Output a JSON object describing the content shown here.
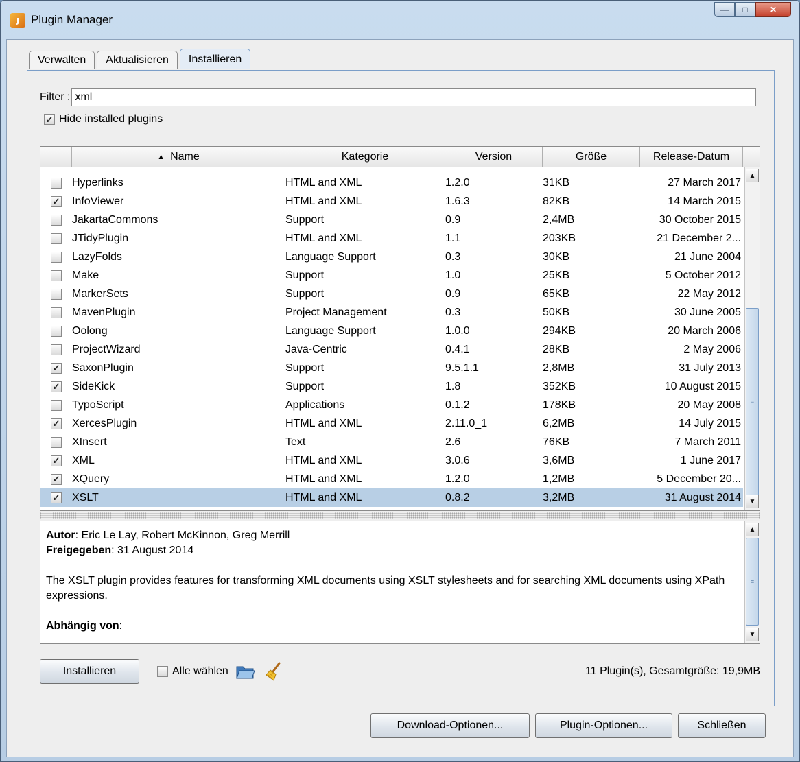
{
  "window": {
    "title": "Plugin Manager",
    "app_icon_text": "J"
  },
  "tabs": [
    {
      "label": "Verwalten"
    },
    {
      "label": "Aktualisieren"
    },
    {
      "label": "Installieren"
    }
  ],
  "filter": {
    "label": "Filter :",
    "value": "xml"
  },
  "hide_installed": {
    "label": "Hide installed plugins",
    "checked": true
  },
  "table": {
    "sort_indicator": "▲",
    "columns": [
      "Name",
      "Kategorie",
      "Version",
      "Größe",
      "Release-Datum"
    ],
    "rows": [
      {
        "checked": false,
        "name": "Hyperlinks",
        "category": "HTML and XML",
        "version": "1.2.0",
        "size": "31KB",
        "date": "27 March 2017"
      },
      {
        "checked": true,
        "name": "InfoViewer",
        "category": "HTML and XML",
        "version": "1.6.3",
        "size": "82KB",
        "date": "14 March 2015"
      },
      {
        "checked": false,
        "name": "JakartaCommons",
        "category": "Support",
        "version": "0.9",
        "size": "2,4MB",
        "date": "30 October 2015"
      },
      {
        "checked": false,
        "name": "JTidyPlugin",
        "category": "HTML and XML",
        "version": "1.1",
        "size": "203KB",
        "date": "21 December 2..."
      },
      {
        "checked": false,
        "name": "LazyFolds",
        "category": "Language Support",
        "version": "0.3",
        "size": "30KB",
        "date": "21 June 2004"
      },
      {
        "checked": false,
        "name": "Make",
        "category": "Support",
        "version": "1.0",
        "size": "25KB",
        "date": "5 October 2012"
      },
      {
        "checked": false,
        "name": "MarkerSets",
        "category": "Support",
        "version": "0.9",
        "size": "65KB",
        "date": "22 May 2012"
      },
      {
        "checked": false,
        "name": "MavenPlugin",
        "category": "Project Management",
        "version": "0.3",
        "size": "50KB",
        "date": "30 June 2005"
      },
      {
        "checked": false,
        "name": "Oolong",
        "category": "Language Support",
        "version": "1.0.0",
        "size": "294KB",
        "date": "20 March 2006"
      },
      {
        "checked": false,
        "name": "ProjectWizard",
        "category": "Java-Centric",
        "version": "0.4.1",
        "size": "28KB",
        "date": "2 May 2006"
      },
      {
        "checked": true,
        "name": "SaxonPlugin",
        "category": "Support",
        "version": "9.5.1.1",
        "size": "2,8MB",
        "date": "31 July 2013"
      },
      {
        "checked": true,
        "name": "SideKick",
        "category": "Support",
        "version": "1.8",
        "size": "352KB",
        "date": "10 August 2015"
      },
      {
        "checked": false,
        "name": "TypoScript",
        "category": "Applications",
        "version": "0.1.2",
        "size": "178KB",
        "date": "20 May 2008"
      },
      {
        "checked": true,
        "name": "XercesPlugin",
        "category": "HTML and XML",
        "version": "2.11.0_1",
        "size": "6,2MB",
        "date": "14 July 2015"
      },
      {
        "checked": false,
        "name": "XInsert",
        "category": "Text",
        "version": "2.6",
        "size": "76KB",
        "date": "7 March 2011"
      },
      {
        "checked": true,
        "name": "XML",
        "category": "HTML and XML",
        "version": "3.0.6",
        "size": "3,6MB",
        "date": "1 June 2017"
      },
      {
        "checked": true,
        "name": "XQuery",
        "category": "HTML and XML",
        "version": "1.2.0",
        "size": "1,2MB",
        "date": "5 December 20..."
      },
      {
        "checked": true,
        "name": "XSLT",
        "category": "HTML and XML",
        "version": "0.8.2",
        "size": "3,2MB",
        "date": "31 August 2014",
        "selected": true
      }
    ]
  },
  "details": {
    "author_label": "Autor",
    "author_value": ": Eric Le Lay, Robert McKinnon, Greg Merrill",
    "released_label": "Freigegeben",
    "released_value": ": 31 August 2014",
    "description": "The XSLT plugin provides features for transforming XML documents using XSLT stylesheets and for searching XML documents using XPath expressions.",
    "depends_label": "Abhängig von",
    "depends_value": ":"
  },
  "actions": {
    "install_label": "Installieren",
    "select_all_label": "Alle wählen",
    "summary": "11 Plugin(s), Gesamtgröße: 19,9MB"
  },
  "footer": {
    "download_options": "Download-Optionen...",
    "plugin_options": "Plugin-Optionen...",
    "close": "Schließen"
  },
  "colors": {
    "selection": "#b8cfe5",
    "accent_border": "#7b9ec8"
  }
}
